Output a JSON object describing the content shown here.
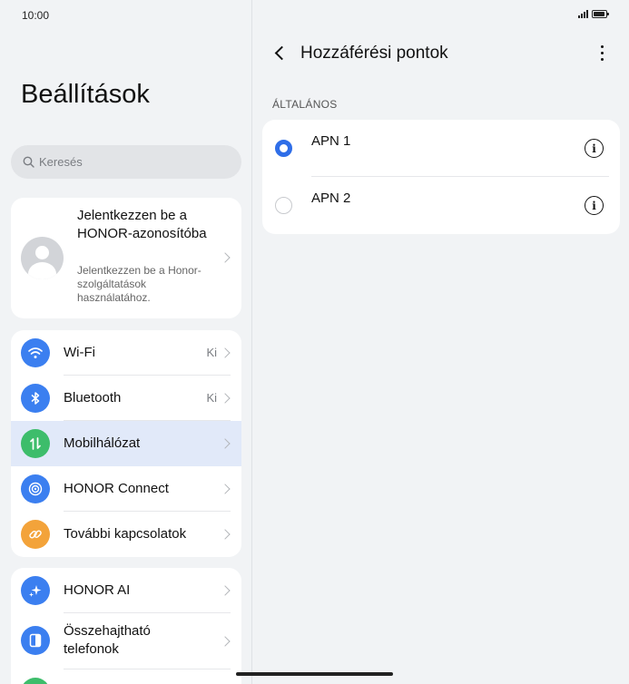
{
  "status_bar": {
    "time": "10:00"
  },
  "left_panel": {
    "title": "Beállítások",
    "search": {
      "placeholder": "Keresés"
    },
    "account": {
      "title": "Jelentkezzen be a HONOR-azonosítóba",
      "subtitle": "Jelentkezzen be a Honor-szolgáltatások használatához."
    },
    "group1": [
      {
        "label": "Wi-Fi",
        "value": "Ki",
        "icon": "wifi-icon",
        "color": "#3b7ff0"
      },
      {
        "label": "Bluetooth",
        "value": "Ki",
        "icon": "bluetooth-icon",
        "color": "#3b7ff0"
      },
      {
        "label": "Mobilhálózat",
        "value": "",
        "icon": "mobile-network-icon",
        "color": "#3dbd6b",
        "selected": true
      },
      {
        "label": "HONOR Connect",
        "value": "",
        "icon": "honor-connect-icon",
        "color": "#3b7ff0"
      },
      {
        "label": "További kapcsolatok",
        "value": "",
        "icon": "link-icon",
        "color": "#f3a33a"
      }
    ],
    "group2": [
      {
        "label": "HONOR AI",
        "icon": "ai-sparkle-icon",
        "color": "#3b7ff0"
      },
      {
        "label": "Összehajtható telefonok",
        "icon": "foldable-icon",
        "color": "#3b7ff0"
      },
      {
        "label": "",
        "icon": "partial-icon",
        "color": "#3dbd6b"
      }
    ]
  },
  "right_panel": {
    "title": "Hozzáférési pontok",
    "section": "ÁLTALÁNOS",
    "apns": [
      {
        "label": "APN 1",
        "selected": true
      },
      {
        "label": "APN 2",
        "selected": false
      }
    ]
  }
}
